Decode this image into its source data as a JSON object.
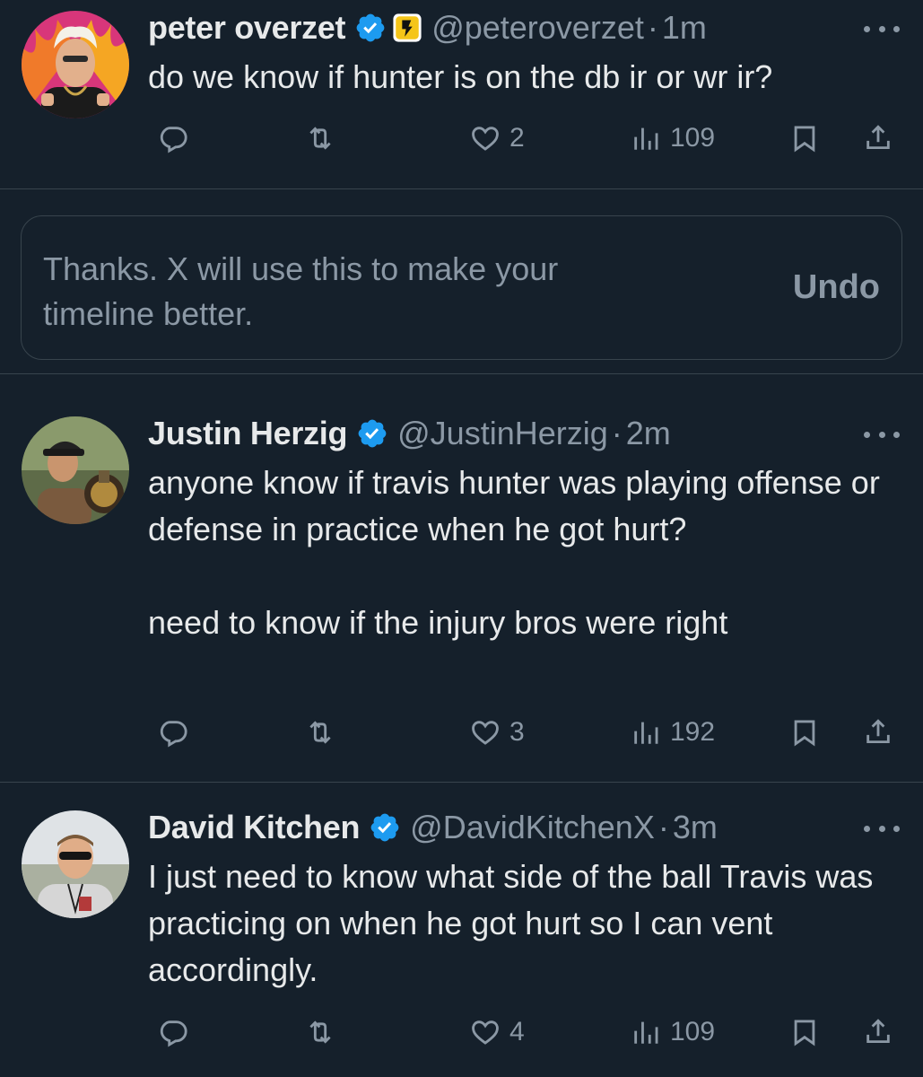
{
  "tweets": [
    {
      "name": "peter overzet",
      "handle": "@peteroverzet",
      "sep": "·",
      "time": "1m",
      "text": "do we know if hunter is on the db ir or wr ir?",
      "likes": "2",
      "views": "109",
      "avatar": "avatar-man-flames"
    },
    {
      "name": "Justin Herzig",
      "handle": "@JustinHerzig",
      "sep": "·",
      "time": "2m",
      "text": "anyone know if travis hunter was playing offense or defense in practice when he got hurt?\n\nneed to know if the injury bros were right",
      "likes": "3",
      "views": "192",
      "avatar": "avatar-man-trophy"
    },
    {
      "name": "David Kitchen",
      "handle": "@DavidKitchenX",
      "sep": "·",
      "time": "3m",
      "text": "I just need to know what side of the ball Travis was practicing on when he got hurt so I can vent accordingly.",
      "likes": "4",
      "views": "109",
      "avatar": "avatar-man-sunglasses"
    }
  ],
  "feedback": {
    "message": "Thanks. X will use this to make your timeline better.",
    "undo_label": "Undo"
  },
  "colors": {
    "background": "#15202b",
    "text": "#e7e9ea",
    "muted": "#8b98a5",
    "verified": "#1d9bf0",
    "divider": "#38444d"
  }
}
